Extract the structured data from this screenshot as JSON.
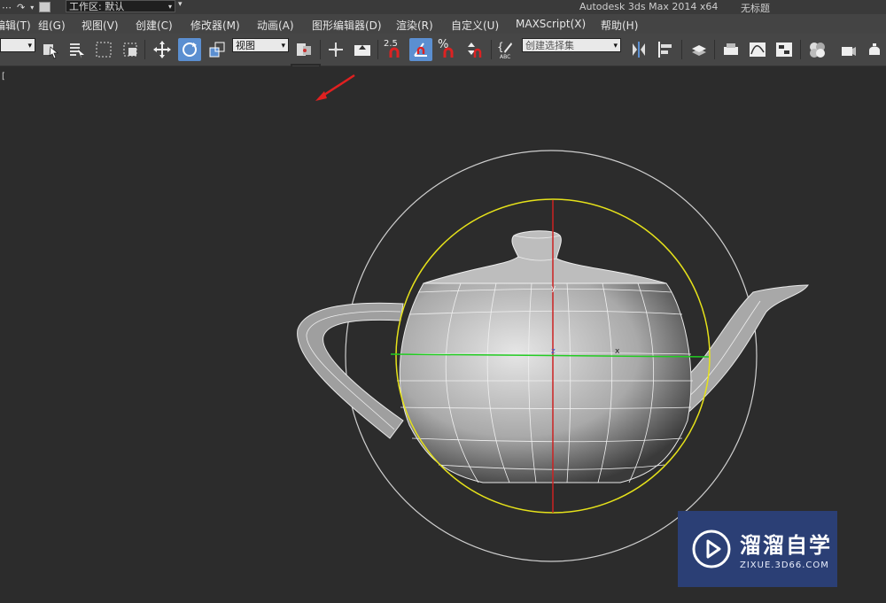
{
  "titlebar": {
    "workspace_label": "工作区: 默认",
    "app_title": "Autodesk 3ds Max  2014 x64",
    "doc_title": "无标题"
  },
  "menu": {
    "items": [
      "编辑(T)",
      "组(G)",
      "视图(V)",
      "创建(C)",
      "修改器(M)",
      "动画(A)",
      "图形编辑器(D)",
      "渲染(R)",
      "自定义(U)",
      "MAXScript(X)",
      "帮助(H)"
    ]
  },
  "toolbar": {
    "ref_coord": "视图",
    "snap_angle_label": "2.5",
    "percent_label": "%",
    "named_selection_placeholder": "创建选择集",
    "abc_label": "ABC"
  },
  "viewport": {
    "label": "[",
    "axis_labels": {
      "x": "x",
      "y": "y",
      "z": "z"
    }
  },
  "watermark": {
    "title": "溜溜自学",
    "url": "ZIXUE.3D66.COM"
  },
  "colors": {
    "accent": "#5b8fd1",
    "gizmo_yellow": "#e6e21a",
    "gizmo_red": "#cc2222",
    "gizmo_green": "#22cc22",
    "watermark_bg": "#2b3f75"
  }
}
